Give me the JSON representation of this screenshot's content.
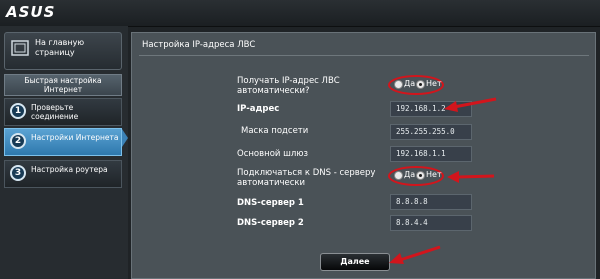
{
  "brand": {
    "logo": "ASUS"
  },
  "sidebar": {
    "home": {
      "label": "На главную страницу"
    },
    "quick_setup_title": "Быстрая настройка Интернет",
    "steps": [
      {
        "num": "1",
        "label": "Проверьте соединение"
      },
      {
        "num": "2",
        "label": "Настройки Интернета"
      },
      {
        "num": "3",
        "label": "Настройка роутера"
      }
    ],
    "active_step": 2
  },
  "panel": {
    "title": "Настройка IP-адреса ЛВС",
    "auto_ip": {
      "label": "Получать IP-адрес ЛВС автоматически?",
      "yes": "Да",
      "no": "Нет",
      "selected": "Нет"
    },
    "ip": {
      "label": "IP-адрес",
      "value": "192.168.1.2"
    },
    "mask": {
      "label": "Маска подсети",
      "value": "255.255.255.0"
    },
    "gateway": {
      "label": "Основной шлюз",
      "value": "192.168.1.1"
    },
    "auto_dns": {
      "label": "Подключаться к DNS - серверу автоматически",
      "yes": "Да",
      "no": "Нет",
      "selected": "Нет"
    },
    "dns1": {
      "label": "DNS-сервер 1",
      "value": "8.8.8.8"
    },
    "dns2": {
      "label": "DNS-сервер 2",
      "value": "8.8.4.4"
    },
    "next": "Далее"
  },
  "colors": {
    "accent": "#2e78ad",
    "annotation": "#d2151c",
    "panel": "#4a5257"
  }
}
